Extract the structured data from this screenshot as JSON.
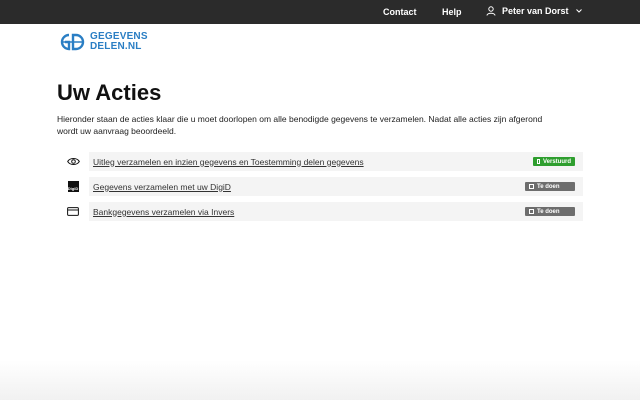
{
  "topbar": {
    "contact_label": "Contact",
    "help_label": "Help",
    "user_name": "Peter van Dorst"
  },
  "logo": {
    "line1": "GEGEVENS",
    "line2": "DELEN.NL",
    "color": "#2a7ec4"
  },
  "page": {
    "title": "Uw Acties",
    "intro": "Hieronder staan de acties klaar die u moet doorlopen om alle benodigde gegevens te verzamelen. Nadat alle acties zijn afgerond wordt uw aanvraag beoordeeld."
  },
  "actions": [
    {
      "icon": "eye-icon",
      "label": "Uitleg verzamelen en inzien gegevens en Toestemming delen gegevens",
      "status": "Verstuurd",
      "status_color": "#2e9e2e"
    },
    {
      "icon": "digid-icon",
      "label": "Gegevens verzamelen met uw DigiD",
      "status": "Te doen",
      "status_color": "#6d6d6d"
    },
    {
      "icon": "card-icon",
      "label": "Bankgegevens verzamelen via Invers",
      "status": "Te doen",
      "status_color": "#6d6d6d"
    }
  ]
}
